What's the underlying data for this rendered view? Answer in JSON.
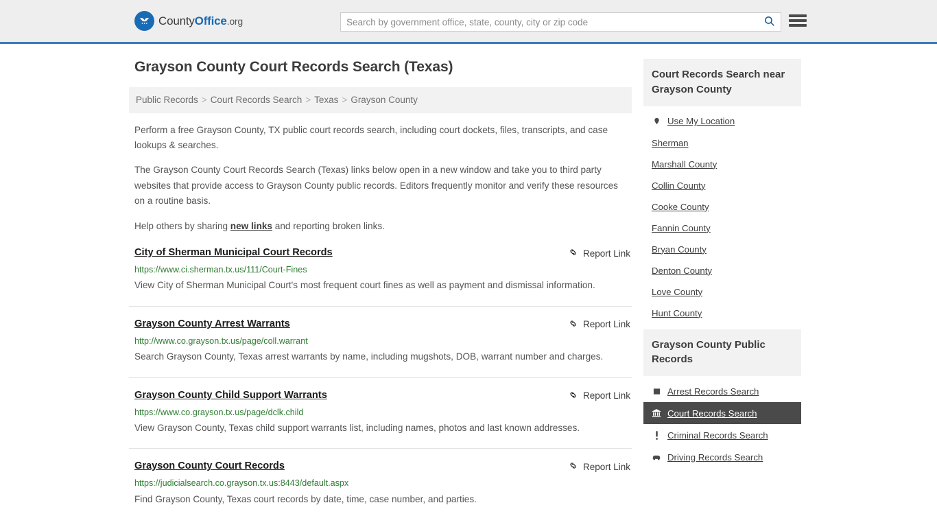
{
  "header": {
    "logo": {
      "part1": "County",
      "part2": "Office",
      "part3": ".org",
      "icon": "eagle-shield-icon"
    },
    "search": {
      "placeholder": "Search by government office, state, county, city or zip code",
      "value": "",
      "button_icon": "search-icon"
    },
    "menu_icon": "hamburger-menu-icon",
    "accent_color": "#3c7ab5"
  },
  "main": {
    "title": "Grayson County Court Records Search (Texas)",
    "breadcrumb": [
      {
        "label": "Public Records"
      },
      {
        "label": "Court Records Search"
      },
      {
        "label": "Texas"
      },
      {
        "label": "Grayson County"
      }
    ],
    "breadcrumb_separator": ">",
    "intro": [
      "Perform a free Grayson County, TX public court records search, including court dockets, files, transcripts, and case lookups & searches.",
      "The Grayson County Court Records Search (Texas) links below open in a new window and take you to third party websites that provide access to Grayson County public records. Editors frequently monitor and verify these resources on a routine basis."
    ],
    "help_prefix": "Help others by sharing ",
    "help_link": "new links",
    "help_suffix": " and reporting broken links.",
    "report_link_label": "Report Link",
    "report_link_icon": "broken-link-icon",
    "results": [
      {
        "title": "City of Sherman Municipal Court Records",
        "url": "https://www.ci.sherman.tx.us/111/Court-Fines",
        "description": "View City of Sherman Municipal Court's most frequent court fines as well as payment and dismissal information."
      },
      {
        "title": "Grayson County Arrest Warrants",
        "url": "http://www.co.grayson.tx.us/page/coll.warrant",
        "description": "Search Grayson County, Texas arrest warrants by name, including mugshots, DOB, warrant number and charges."
      },
      {
        "title": "Grayson County Child Support Warrants",
        "url": "https://www.co.grayson.tx.us/page/dclk.child",
        "description": "View Grayson County, Texas child support warrants list, including names, photos and last known addresses."
      },
      {
        "title": "Grayson County Court Records",
        "url": "https://judicialsearch.co.grayson.tx.us:8443/default.aspx",
        "description": "Find Grayson County, Texas court records by date, time, case number, and parties."
      }
    ]
  },
  "sidebar": {
    "nearby": {
      "heading": "Court Records Search near Grayson County",
      "items": [
        {
          "label": "Use My Location",
          "icon": "map-pin-icon"
        },
        {
          "label": "Sherman",
          "icon": ""
        },
        {
          "label": "Marshall County",
          "icon": ""
        },
        {
          "label": "Collin County",
          "icon": ""
        },
        {
          "label": "Cooke County",
          "icon": ""
        },
        {
          "label": "Fannin County",
          "icon": ""
        },
        {
          "label": "Bryan County",
          "icon": ""
        },
        {
          "label": "Denton County",
          "icon": ""
        },
        {
          "label": "Love County",
          "icon": ""
        },
        {
          "label": "Hunt County",
          "icon": ""
        }
      ]
    },
    "public_records": {
      "heading": "Grayson County Public Records",
      "items": [
        {
          "label": "Arrest Records Search",
          "icon": "square-icon",
          "active": false
        },
        {
          "label": "Court Records Search",
          "icon": "bank-building-icon",
          "active": true
        },
        {
          "label": "Criminal Records Search",
          "icon": "exclamation-icon",
          "active": false
        },
        {
          "label": "Driving Records Search",
          "icon": "car-icon",
          "active": false
        }
      ],
      "active_bg": "#4a4a4a"
    }
  }
}
